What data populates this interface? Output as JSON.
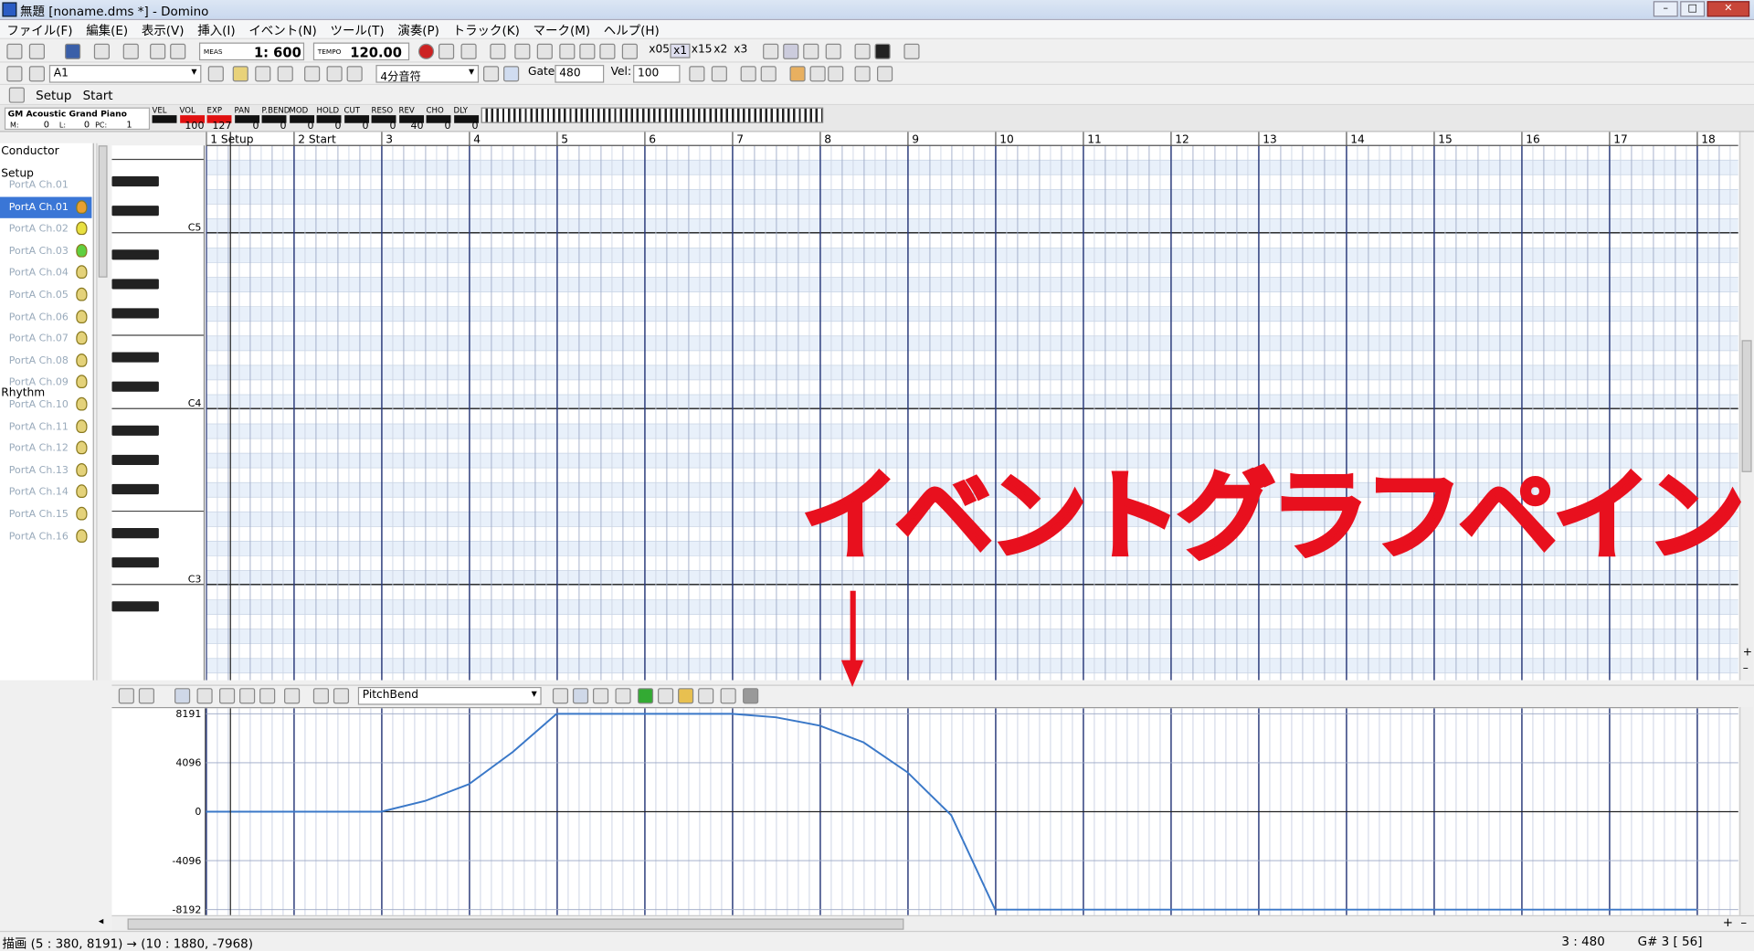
{
  "window": {
    "title": "無題 [noname.dms *] - Domino",
    "minimize": "–",
    "maximize": "□",
    "close": "✕"
  },
  "menu": [
    "ファイル(F)",
    "編集(E)",
    "表示(V)",
    "挿入(I)",
    "イベント(N)",
    "ツール(T)",
    "演奏(P)",
    "トラック(K)",
    "マーク(M)",
    "ヘルプ(H)"
  ],
  "toolbar1": {
    "meas_label": "MEAS",
    "position": "1: 600",
    "tempo_label": "TEMPO",
    "tempo": "120.00",
    "x05": "x05",
    "x1": "x1",
    "x15": "x15",
    "x2": "x2",
    "x3": "x3"
  },
  "toolbar2": {
    "track_select": "A1",
    "note_length": "4分音符",
    "gate_label": "Gate:",
    "gate": "480",
    "vel_label": "Vel:",
    "vel": "100"
  },
  "toolbar3": {
    "setup": "Setup",
    "start": "Start"
  },
  "trackinfo": {
    "instrument": "GM Acoustic Grand Piano",
    "m_label": "M:",
    "m_val": "0",
    "l_label": "L:",
    "l_val": "0",
    "pc_label": "PC:",
    "pc_val": "1",
    "controls": [
      {
        "label": "VEL",
        "value": ""
      },
      {
        "label": "VOL",
        "value": "100"
      },
      {
        "label": "EXP",
        "value": "127"
      },
      {
        "label": "PAN",
        "value": "0"
      },
      {
        "label": "P.BEND",
        "value": "0"
      },
      {
        "label": "MOD",
        "value": "0"
      },
      {
        "label": "HOLD",
        "value": "0"
      },
      {
        "label": "CUT",
        "value": "0"
      },
      {
        "label": "RESO",
        "value": "0"
      },
      {
        "label": "REV",
        "value": "40"
      },
      {
        "label": "CHO",
        "value": "0"
      },
      {
        "label": "DLY",
        "value": "0"
      }
    ]
  },
  "tracks": {
    "conductor": "Conductor",
    "setup": "Setup",
    "rhythm": "Rhythm",
    "channels": [
      "PortA  Ch.01",
      "PortA  Ch.01",
      "PortA  Ch.02",
      "PortA  Ch.03",
      "PortA  Ch.04",
      "PortA  Ch.05",
      "PortA  Ch.06",
      "PortA  Ch.07",
      "PortA  Ch.08",
      "PortA  Ch.09",
      "PortA  Ch.10",
      "PortA  Ch.11",
      "PortA  Ch.12",
      "PortA  Ch.13",
      "PortA  Ch.14",
      "PortA  Ch.15",
      "PortA  Ch.16"
    ]
  },
  "piano": {
    "octaves": [
      "C5",
      "C4",
      "C3"
    ]
  },
  "ruler": {
    "measures": [
      "1 Setup",
      "2 Start",
      "3",
      "4",
      "5",
      "6",
      "7",
      "8",
      "9",
      "10",
      "11",
      "12",
      "13",
      "14",
      "15",
      "16",
      "17",
      "18"
    ]
  },
  "event_toolbar": {
    "event_type": "PitchBend"
  },
  "graph": {
    "yticks": [
      "8191",
      "4096",
      "0",
      "-4096",
      "-8192"
    ],
    "chart_data": {
      "type": "line",
      "series": [
        {
          "points": [
            [
              1,
              0
            ],
            [
              2,
              0
            ],
            [
              3,
              0
            ],
            [
              3.5,
              900
            ],
            [
              4,
              2300
            ],
            [
              4.5,
              5000
            ],
            [
              5,
              8191
            ],
            [
              6,
              8191
            ],
            [
              7,
              8191
            ],
            [
              7.5,
              7900
            ],
            [
              8,
              7200
            ],
            [
              8.5,
              5800
            ],
            [
              9,
              3300
            ],
            [
              9.5,
              -300
            ],
            [
              10,
              -8192
            ],
            [
              11,
              -8192
            ],
            [
              18,
              -8192
            ]
          ]
        }
      ],
      "ylim": [
        -8192,
        8191
      ],
      "xlim": [
        1,
        18.5
      ]
    }
  },
  "status": {
    "left": "描画 (5 : 380, 8191) → (10 : 1880, -7968)",
    "pos": "3 : 480",
    "note": "G# 3 [ 56]"
  },
  "annotation": {
    "text": "イベントグラフペイン",
    "color": "#e8101e",
    "arrow": "↓"
  }
}
